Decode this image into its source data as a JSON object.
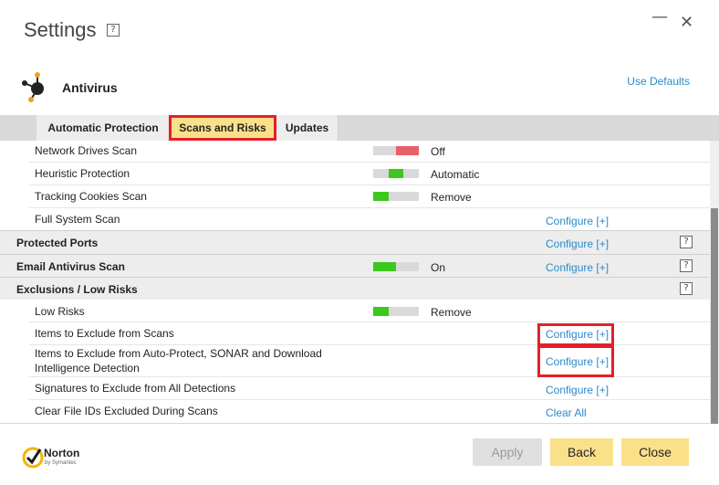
{
  "window": {
    "title": "Settings",
    "help": "?",
    "minimize": "—",
    "close": "✕"
  },
  "header": {
    "title": "Antivirus",
    "use_defaults": "Use Defaults",
    "icon": "antivirus-icon"
  },
  "tabs": [
    {
      "label": "Automatic Protection",
      "active": false
    },
    {
      "label": "Scans and Risks",
      "active": true
    },
    {
      "label": "Updates",
      "active": false
    }
  ],
  "rows": [
    {
      "label": "Network Drives Scan",
      "status": "Off",
      "toggle": "off"
    },
    {
      "label": "Heuristic Protection",
      "status": "Automatic",
      "toggle": "middle"
    },
    {
      "label": "Tracking Cookies Scan",
      "status": "Remove",
      "toggle": "left"
    },
    {
      "label": "Full System Scan",
      "action": "Configure [+]"
    },
    {
      "label": "Protected Ports",
      "action": "Configure [+]",
      "help": "?",
      "section": true
    },
    {
      "label": "Email Antivirus Scan",
      "status": "On",
      "toggle": "on",
      "action": "Configure [+]",
      "help": "?",
      "section": true
    },
    {
      "label": "Exclusions / Low Risks",
      "help": "?",
      "section": true
    },
    {
      "label": "Low Risks",
      "status": "Remove",
      "toggle": "left"
    },
    {
      "label": "Items to Exclude from Scans",
      "action": "Configure [+]"
    },
    {
      "label": "Items to Exclude from Auto-Protect, SONAR and Download",
      "label2": "Intelligence Detection",
      "action": "Configure [+]"
    },
    {
      "label": "Signatures to Exclude from All Detections",
      "action": "Configure [+]"
    },
    {
      "label": "Clear File IDs Excluded During Scans",
      "action": "Clear All"
    }
  ],
  "footer": {
    "brand": "Norton",
    "brand_sub": "by Symantec",
    "apply": "Apply",
    "back": "Back",
    "close": "Close"
  },
  "colors": {
    "accent_link": "#2a8ac9",
    "toggle_on": "#3cc81e",
    "toggle_off": "#e8606a",
    "button_yellow": "#fbe08a",
    "highlight_red": "#e3202a"
  }
}
